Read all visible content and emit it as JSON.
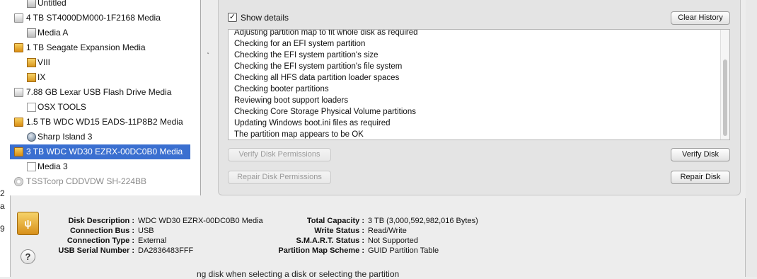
{
  "left_edge_fragments": [
    "2",
    "a",
    "9"
  ],
  "sidebar": {
    "items": [
      {
        "label": "Untitled",
        "icon": "volume-icon",
        "indent": 1
      },
      {
        "label": "4 TB ST4000DM000-1F2168 Media",
        "icon": "hard-disk-icon",
        "indent": 0
      },
      {
        "label": "Media A",
        "icon": "volume-icon",
        "indent": 1
      },
      {
        "label": "1 TB Seagate Expansion Media",
        "icon": "external-disk-icon",
        "indent": 0
      },
      {
        "label": "VIII",
        "icon": "external-volume-icon",
        "indent": 1
      },
      {
        "label": "IX",
        "icon": "external-volume-icon",
        "indent": 1
      },
      {
        "label": "7.88 GB Lexar USB Flash Drive Media",
        "icon": "hard-disk-icon",
        "indent": 0
      },
      {
        "label": "OSX TOOLS",
        "icon": "volume-icon",
        "indent": 1
      },
      {
        "label": "1.5 TB WDC WD15 EADS-11P8B2 Media",
        "icon": "external-disk-icon",
        "indent": 0
      },
      {
        "label": "Sharp Island 3",
        "icon": "network-volume-icon",
        "indent": 1
      },
      {
        "label": "3 TB WDC WD30 EZRX-00DC0B0 Media",
        "icon": "external-disk-icon",
        "indent": 0,
        "selected": true
      },
      {
        "label": "Media 3",
        "icon": "document-icon",
        "indent": 1
      },
      {
        "label": "TSSTcorp CDDVDW SH-224BB",
        "icon": "optical-drive-icon",
        "indent": 0,
        "dim": true
      }
    ]
  },
  "details": {
    "show_details_label": "Show details",
    "show_details_checked": "✓",
    "clear_history_label": "Clear History",
    "log_lines": [
      "Adjusting partition map to fit whole disk as required",
      "Checking for an EFI system partition",
      "Checking the EFI system partition's size",
      "Checking the EFI system partition's file system",
      "Checking all HFS data partition loader spaces",
      "Checking booter partitions",
      "Reviewing boot support loaders",
      "Checking Core Storage Physical Volume partitions",
      "Updating Windows boot.ini files as required",
      "The partition map appears to be OK"
    ]
  },
  "buttons": {
    "verify_permissions": "Verify Disk Permissions",
    "repair_permissions": "Repair Disk Permissions",
    "verify_disk": "Verify Disk",
    "repair_disk": "Repair Disk"
  },
  "info": {
    "disk_description_label": "Disk Description :",
    "disk_description": "WDC WD30 EZRX-00DC0B0 Media",
    "connection_bus_label": "Connection Bus :",
    "connection_bus": "USB",
    "connection_type_label": "Connection Type :",
    "connection_type": "External",
    "usb_serial_label": "USB Serial Number :",
    "usb_serial": "DA2836483FFF",
    "total_capacity_label": "Total Capacity :",
    "total_capacity": "3 TB (3,000,592,982,016 Bytes)",
    "write_status_label": "Write Status :",
    "write_status": "Read/Write",
    "smart_status_label": "S.M.A.R.T. Status :",
    "smart_status": "Not Supported",
    "partition_scheme_label": "Partition Map Scheme :",
    "partition_scheme": "GUID Partition Table"
  },
  "usb_icon_glyph": "ψ",
  "help_glyph": "?",
  "splitter_glyph": "˛",
  "bottom_fragment": "ng disk when selecting a disk or selecting the partition"
}
